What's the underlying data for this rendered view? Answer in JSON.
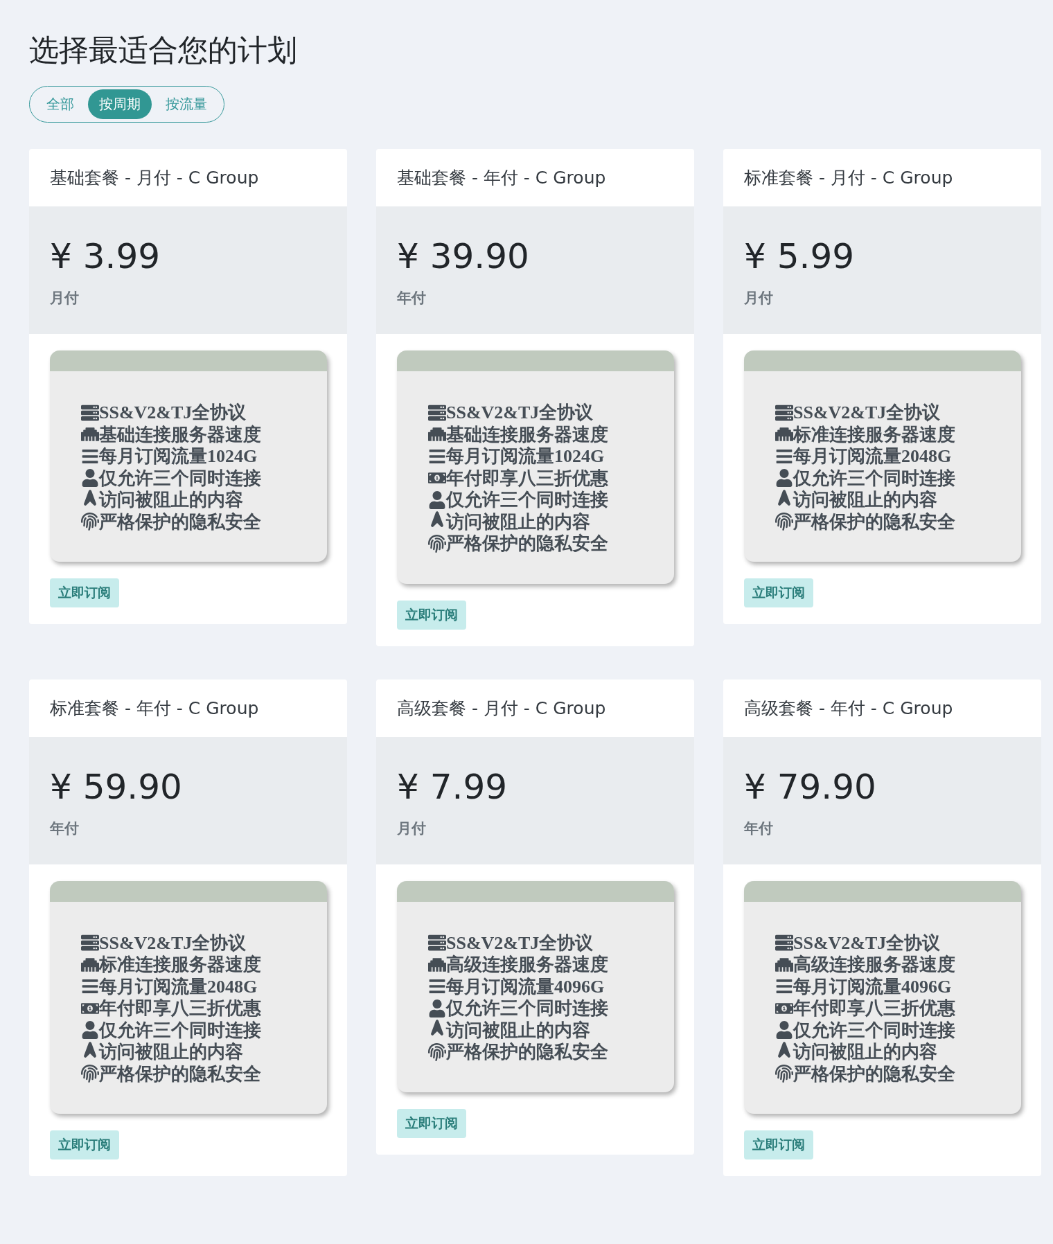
{
  "title": "选择最适合您的计划",
  "filters": [
    {
      "label": "全部",
      "selected": false
    },
    {
      "label": "按周期",
      "selected": true
    },
    {
      "label": "按流量",
      "selected": false
    }
  ],
  "plans": [
    {
      "name": "基础套餐 - 月付 - C Group",
      "price": "¥ 3.99",
      "period": "月付",
      "features": [
        {
          "kind": "server",
          "text": "SS&V2&TJ全协议"
        },
        {
          "kind": "ethernet",
          "text": "基础连接服务器速度"
        },
        {
          "kind": "bars",
          "text": "每月订阅流量1024G"
        },
        {
          "kind": "user",
          "text": "仅允许三个同时连接"
        },
        {
          "kind": "plane",
          "text": "访问被阻止的内容"
        },
        {
          "kind": "fingerprint",
          "text": "严格保护的隐私安全"
        }
      ],
      "button": "立即订阅"
    },
    {
      "name": "基础套餐 - 年付 - C Group",
      "price": "¥ 39.90",
      "period": "年付",
      "features": [
        {
          "kind": "server",
          "text": "SS&V2&TJ全协议"
        },
        {
          "kind": "ethernet",
          "text": "基础连接服务器速度"
        },
        {
          "kind": "bars",
          "text": "每月订阅流量1024G"
        },
        {
          "kind": "money",
          "text": "年付即享八三折优惠"
        },
        {
          "kind": "user",
          "text": "仅允许三个同时连接"
        },
        {
          "kind": "plane",
          "text": "访问被阻止的内容"
        },
        {
          "kind": "fingerprint",
          "text": "严格保护的隐私安全"
        }
      ],
      "button": "立即订阅"
    },
    {
      "name": "标准套餐 - 月付 - C Group",
      "price": "¥ 5.99",
      "period": "月付",
      "features": [
        {
          "kind": "server",
          "text": "SS&V2&TJ全协议"
        },
        {
          "kind": "ethernet",
          "text": "标准连接服务器速度"
        },
        {
          "kind": "bars",
          "text": "每月订阅流量2048G"
        },
        {
          "kind": "user",
          "text": "仅允许三个同时连接"
        },
        {
          "kind": "plane",
          "text": "访问被阻止的内容"
        },
        {
          "kind": "fingerprint",
          "text": "严格保护的隐私安全"
        }
      ],
      "button": "立即订阅"
    },
    {
      "name": "标准套餐 - 年付 - C Group",
      "price": "¥ 59.90",
      "period": "年付",
      "features": [
        {
          "kind": "server",
          "text": "SS&V2&TJ全协议"
        },
        {
          "kind": "ethernet",
          "text": "标准连接服务器速度"
        },
        {
          "kind": "bars",
          "text": "每月订阅流量2048G"
        },
        {
          "kind": "money",
          "text": "年付即享八三折优惠"
        },
        {
          "kind": "user",
          "text": "仅允许三个同时连接"
        },
        {
          "kind": "plane",
          "text": "访问被阻止的内容"
        },
        {
          "kind": "fingerprint",
          "text": "严格保护的隐私安全"
        }
      ],
      "button": "立即订阅"
    },
    {
      "name": "高级套餐 - 月付 - C Group",
      "price": "¥ 7.99",
      "period": "月付",
      "features": [
        {
          "kind": "server",
          "text": "SS&V2&TJ全协议"
        },
        {
          "kind": "ethernet",
          "text": "高级连接服务器速度"
        },
        {
          "kind": "bars",
          "text": "每月订阅流量4096G"
        },
        {
          "kind": "user",
          "text": "仅允许三个同时连接"
        },
        {
          "kind": "plane",
          "text": "访问被阻止的内容"
        },
        {
          "kind": "fingerprint",
          "text": "严格保护的隐私安全"
        }
      ],
      "button": "立即订阅"
    },
    {
      "name": "高级套餐 - 年付 - C Group",
      "price": "¥ 79.90",
      "period": "年付",
      "features": [
        {
          "kind": "server",
          "text": "SS&V2&TJ全协议"
        },
        {
          "kind": "ethernet",
          "text": "高级连接服务器速度"
        },
        {
          "kind": "bars",
          "text": "每月订阅流量4096G"
        },
        {
          "kind": "money",
          "text": "年付即享八三折优惠"
        },
        {
          "kind": "user",
          "text": "仅允许三个同时连接"
        },
        {
          "kind": "plane",
          "text": "访问被阻止的内容"
        },
        {
          "kind": "fingerprint",
          "text": "严格保护的隐私安全"
        }
      ],
      "button": "立即订阅"
    }
  ]
}
